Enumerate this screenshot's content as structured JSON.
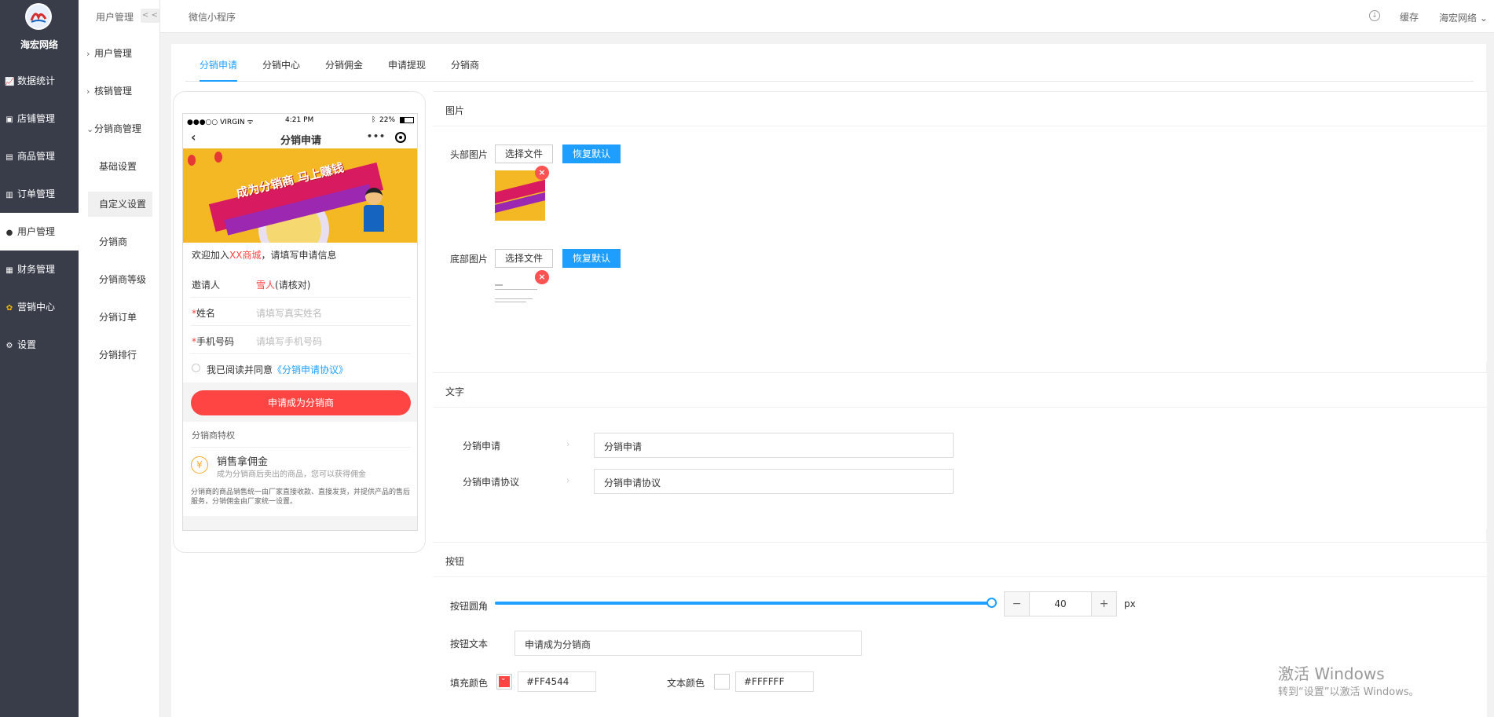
{
  "brand": {
    "name": "海宏网络"
  },
  "main_nav": [
    {
      "label": "数据统计",
      "icon": "chart-icon"
    },
    {
      "label": "店铺管理",
      "icon": "store-icon"
    },
    {
      "label": "商品管理",
      "icon": "goods-icon"
    },
    {
      "label": "订单管理",
      "icon": "order-icon"
    },
    {
      "label": "用户管理",
      "icon": "user-icon"
    },
    {
      "label": "财务管理",
      "icon": "finance-icon"
    },
    {
      "label": "营销中心",
      "icon": "marketing-icon"
    },
    {
      "label": "设置",
      "icon": "settings-icon"
    }
  ],
  "sub_nav": {
    "title": "用户管理",
    "collapse": "< <",
    "groups": [
      "用户管理",
      "核销管理",
      "分销商管理"
    ],
    "children": [
      "基础设置",
      "自定义设置",
      "分销商",
      "分销商等级",
      "分销订单",
      "分销排行"
    ]
  },
  "topbar": {
    "title": "微信小程序",
    "cache": "缓存",
    "user": "海宏网络"
  },
  "tabs": [
    "分销申请",
    "分销中心",
    "分销佣金",
    "申请提现",
    "分销商"
  ],
  "phone": {
    "status": {
      "carrier": "●●●○○ VIRGIN ᯤ",
      "time": "4:21 PM",
      "battery": "22%"
    },
    "nav_title": "分销申请",
    "banner_text": "成为分销商  马上赚钱",
    "welcome_pre": "欢迎加入",
    "welcome_hl": "XX商城",
    "welcome_post": "，请填写申请信息",
    "inviter_label": "邀请人",
    "inviter_value": "雪人",
    "inviter_note": "(请核对)",
    "name_label": "姓名",
    "name_placeholder": "请填写真实姓名",
    "phone_label": "手机号码",
    "phone_placeholder": "请填写手机号码",
    "agree_pre": "我已阅读并同意",
    "agree_link": "《分销申请协议》",
    "apply_button": "申请成为分销商",
    "privilege_title": "分销商特权",
    "privilege_icon": "¥",
    "privilege_name": "销售拿佣金",
    "privilege_desc": "成为分销商后卖出的商品，您可以获得佣金",
    "privilege_note": "分销商的商品销售统一由厂家直接收款、直接发货，并提供产品的售后服务，分销佣金由厂家统一设置。"
  },
  "image_panel": {
    "title": "图片",
    "header_label": "头部图片",
    "footer_label": "底部图片",
    "choose_file": "选择文件",
    "reset": "恢复默认",
    "delete": "×"
  },
  "text_panel": {
    "title": "文字",
    "rows": [
      {
        "label": "分销申请",
        "value": "分销申请"
      },
      {
        "label": "分销申请协议",
        "value": "分销申请协议"
      }
    ]
  },
  "button_panel": {
    "title": "按钮",
    "radius_label": "按钮圆角",
    "radius_value": "40",
    "radius_unit": "px",
    "text_label": "按钮文本",
    "text_value": "申请成为分销商",
    "fill_label": "填充颜色",
    "fill_value": "#FF4544",
    "text_color_label": "文本颜色",
    "text_color_value": "#FFFFFF"
  },
  "watermark": {
    "line1": "激活 Windows",
    "line2": "转到“设置”以激活 Windows。"
  },
  "colors": {
    "primary": "#1e9fff",
    "danger": "#ff4544",
    "sidebar": "#393d49"
  }
}
